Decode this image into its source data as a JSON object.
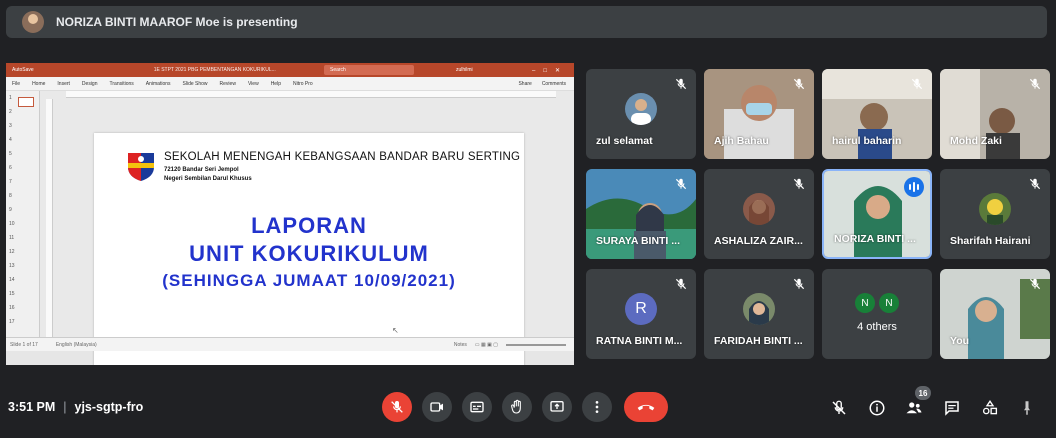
{
  "banner": {
    "text": "NORIZA BINTI MAAROF Moe is presenting"
  },
  "ppt": {
    "autosave": "AutoSave",
    "file_title": "1E STPT 2021 PBG PEMBENTANGAN KOKURIKUL...",
    "search_placeholder": "Search",
    "user": "zulhilmi",
    "menu": [
      "File",
      "Home",
      "Insert",
      "Design",
      "Transitions",
      "Animations",
      "Slide Show",
      "Review",
      "View",
      "Help",
      "Nitro Pro"
    ],
    "share_label": "Share",
    "comments_label": "Comments",
    "slide_numbers": [
      "1",
      "2",
      "3",
      "4",
      "5",
      "6",
      "7",
      "8",
      "9",
      "10",
      "11",
      "12",
      "13",
      "14",
      "15",
      "16",
      "17"
    ],
    "status_slide": "Slide 1 of 17",
    "status_lang": "English (Malaysia)",
    "status_notes": "Notes"
  },
  "slide": {
    "school": "SEKOLAH MENENGAH KEBANGSAAN BANDAR BARU SERTING",
    "address1": "72120 Bandar Seri Jempol",
    "address2": "Negeri Sembilan Darul Khusus",
    "heading1": "LAPORAN",
    "heading2": "UNIT KOKURIKULUM",
    "heading3": "(SEHINGGA JUMAAT 10/09/2021)"
  },
  "participants": [
    {
      "name": "zul selamat",
      "muted": true
    },
    {
      "name": "Ajih Bahau",
      "muted": true
    },
    {
      "name": "hairul baharin",
      "muted": true
    },
    {
      "name": "Mohd Zaki",
      "muted": true
    },
    {
      "name": "SURAYA BINTI ...",
      "muted": true
    },
    {
      "name": "ASHALIZA ZAIR...",
      "muted": true
    },
    {
      "name": "NORIZA BINTI ...",
      "muted": false,
      "speaking": true
    },
    {
      "name": "Sharifah Hairani",
      "muted": true
    },
    {
      "name": "RATNA BINTI M...",
      "muted": true,
      "initial": "R"
    },
    {
      "name": "FARIDAH BINTI ...",
      "muted": true
    },
    {
      "name": "4 others",
      "initials": [
        "N",
        "N"
      ]
    },
    {
      "name": "You",
      "muted": true
    }
  ],
  "meeting": {
    "time": "3:51 PM",
    "code": "yjs-sgtp-fro",
    "people_count": "16"
  },
  "controls": [
    "mic-off-icon",
    "camera-icon",
    "captions-icon",
    "raise-hand-icon",
    "present-icon",
    "more-icon",
    "end-call-icon"
  ],
  "side_controls": [
    "host-controls-icon",
    "info-icon",
    "people-icon",
    "chat-icon",
    "activities-icon",
    "lock-icon"
  ],
  "colors": {
    "end_call": "#ea4335",
    "ppt_accent": "#b7472a",
    "slide_heading": "#2233cc",
    "active_border": "#8ab4f8"
  }
}
